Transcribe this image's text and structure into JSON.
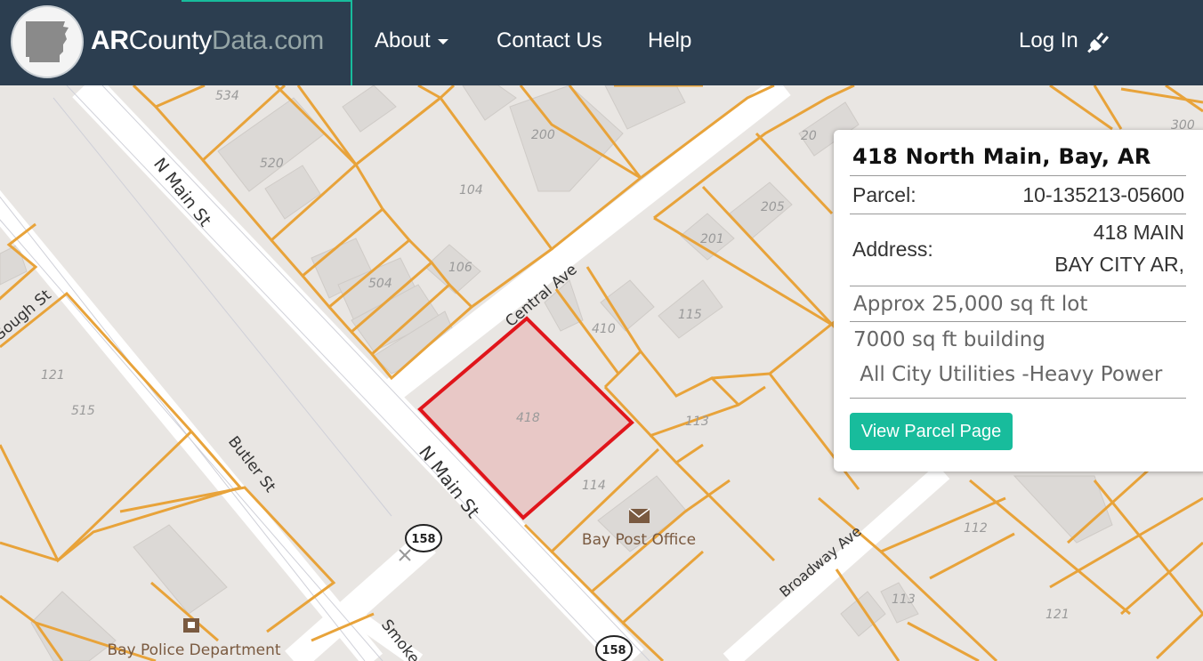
{
  "nav": {
    "brand_part1": "AR",
    "brand_part2": "County",
    "brand_part3": "Data",
    "brand_part4": ".com",
    "about": "About",
    "contact": "Contact Us",
    "help": "Help",
    "login": "Log In",
    "accent_color": "#18bc9c",
    "bg_color": "#2c3e50"
  },
  "map": {
    "streets": {
      "n_main_1": "N Main St",
      "n_main_2": "N Main St",
      "central": "Central Ave",
      "gough": "Gough St",
      "butler": "Butler St",
      "broadway": "Broadway Ave",
      "smoke": "Smoke"
    },
    "highway_shield": "158",
    "highway_shield_2": "158",
    "poi_post": "Bay Post Office",
    "poi_police": "Bay Police Department",
    "lots": {
      "l534": "534",
      "l520": "520",
      "l200": "200",
      "l104": "104",
      "l106": "106",
      "l504": "504",
      "l410": "410",
      "l418": "418",
      "l115": "115",
      "l201": "201",
      "l205": "205",
      "l20x": "20",
      "l300": "300",
      "l113a": "113",
      "l114": "114",
      "l121a": "121",
      "l515": "515",
      "l112": "112",
      "l113b": "113",
      "l121b": "121"
    },
    "parcel_line_color": "#e8a33a",
    "selected_parcel_color": "#e0151b"
  },
  "popup": {
    "title": "418 North Main, Bay, AR",
    "parcel_label": "Parcel:",
    "parcel_value": "10-135213-05600",
    "address_label": "Address:",
    "address_line1": "418 MAIN",
    "address_line2": "BAY CITY AR,",
    "note1": "Approx 25,000 sq ft lot",
    "note2": "7000 sq ft building",
    "note3": " All City Utilities -Heavy Power",
    "button": "View Parcel Page"
  }
}
